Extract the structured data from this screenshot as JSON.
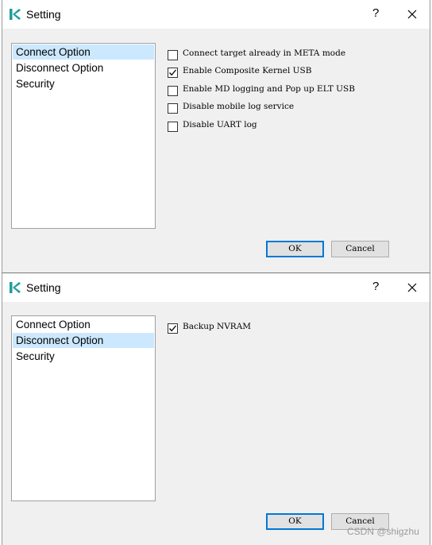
{
  "dialogs": [
    {
      "title": "Setting",
      "help": "?",
      "list": [
        "Connect Option",
        "Disconnect Option",
        "Security"
      ],
      "selected_index": 0,
      "options": [
        {
          "label": "Connect target already in META mode",
          "checked": false
        },
        {
          "label": "Enable Composite Kernel USB",
          "checked": true
        },
        {
          "label": "Enable MD logging and Pop up ELT USB",
          "checked": false
        },
        {
          "label": "Disable mobile log service",
          "checked": false
        },
        {
          "label": "Disable UART log",
          "checked": false
        }
      ],
      "ok_label": "OK",
      "cancel_label": "Cancel"
    },
    {
      "title": "Setting",
      "help": "?",
      "list": [
        "Connect Option",
        "Disconnect Option",
        "Security"
      ],
      "selected_index": 1,
      "options": [
        {
          "label": "Backup NVRAM",
          "checked": true
        }
      ],
      "ok_label": "OK",
      "cancel_label": "Cancel"
    }
  ],
  "watermark": "CSDN @shigzhu",
  "colors": {
    "selection": "#cce8ff",
    "accent": "#0078d7",
    "icon_teal": "#1e9e9a"
  }
}
